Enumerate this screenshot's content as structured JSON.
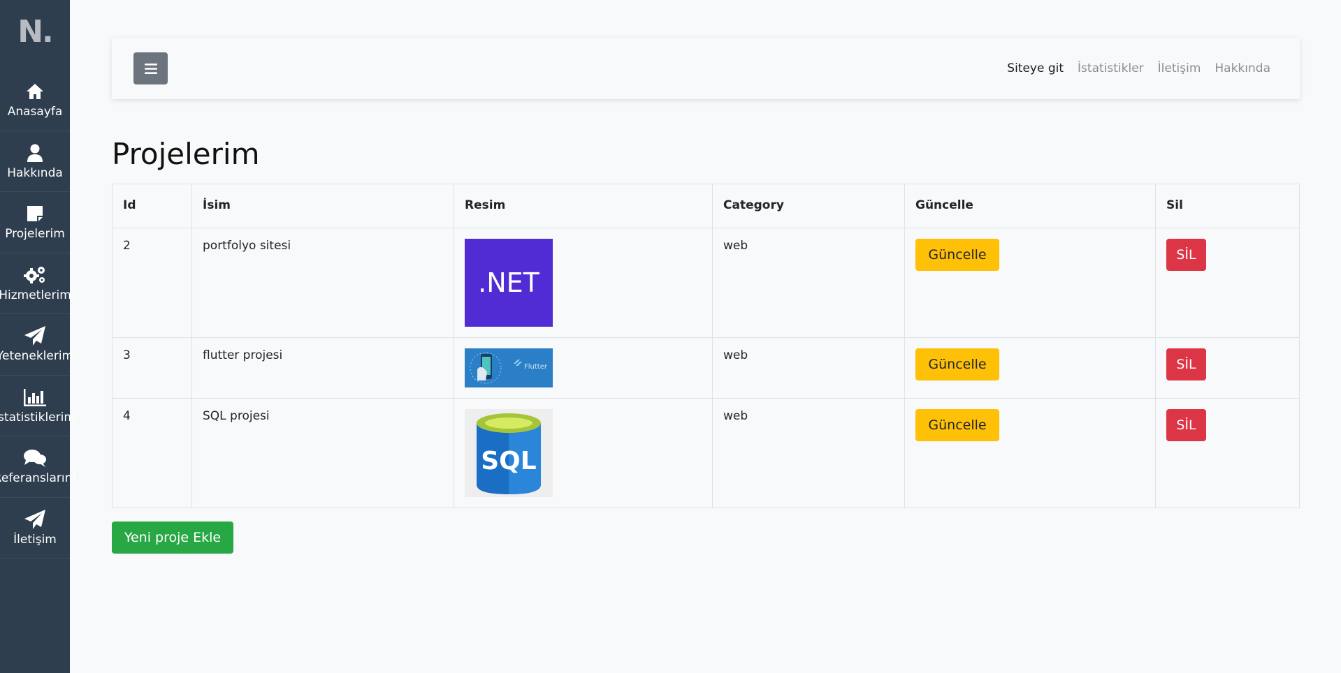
{
  "sidebar": {
    "logo": "N.",
    "items": [
      {
        "label": "Anasayfa",
        "icon": "home-icon"
      },
      {
        "label": "Hakkında",
        "icon": "user-icon"
      },
      {
        "label": "Projelerim",
        "icon": "sticky-note-icon"
      },
      {
        "label": "Hizmetlerim",
        "icon": "gears-icon"
      },
      {
        "label": "Yeteneklerim",
        "icon": "paper-plane-icon"
      },
      {
        "label": "İstatistiklerim",
        "icon": "bar-chart-icon"
      },
      {
        "label": "Referanslarım",
        "icon": "comments-icon"
      },
      {
        "label": "İletişim",
        "icon": "paper-plane-icon"
      }
    ]
  },
  "topbar": {
    "toggle_icon": "hamburger-icon",
    "links": [
      "Siteye git",
      "İstatistikler",
      "İletişim",
      "Hakkında"
    ]
  },
  "page": {
    "title": "Projelerim"
  },
  "table": {
    "headers": [
      "Id",
      "İsim",
      "Resim",
      "Category",
      "Güncelle",
      "Sil"
    ],
    "rows": [
      {
        "id": "2",
        "name": "portfolyo sitesi",
        "image": "dotnet-logo",
        "image_text": ".NET",
        "category": "web",
        "update": "Güncelle",
        "delete": "SİL"
      },
      {
        "id": "3",
        "name": "flutter projesi",
        "image": "flutter-banner",
        "image_text": "Flutter",
        "category": "web",
        "update": "Güncelle",
        "delete": "SİL"
      },
      {
        "id": "4",
        "name": "SQL projesi",
        "image": "sql-logo",
        "image_text": "SQL",
        "category": "web",
        "update": "Güncelle",
        "delete": "SİL"
      }
    ]
  },
  "actions": {
    "add_label": "Yeni proje Ekle"
  },
  "colors": {
    "sidebar_bg": "#2f3e4e",
    "warning": "#ffc107",
    "danger": "#dc3545",
    "success": "#28a745",
    "dotnet_purple": "#512bd4",
    "sql_blue": "#1a73c8"
  }
}
